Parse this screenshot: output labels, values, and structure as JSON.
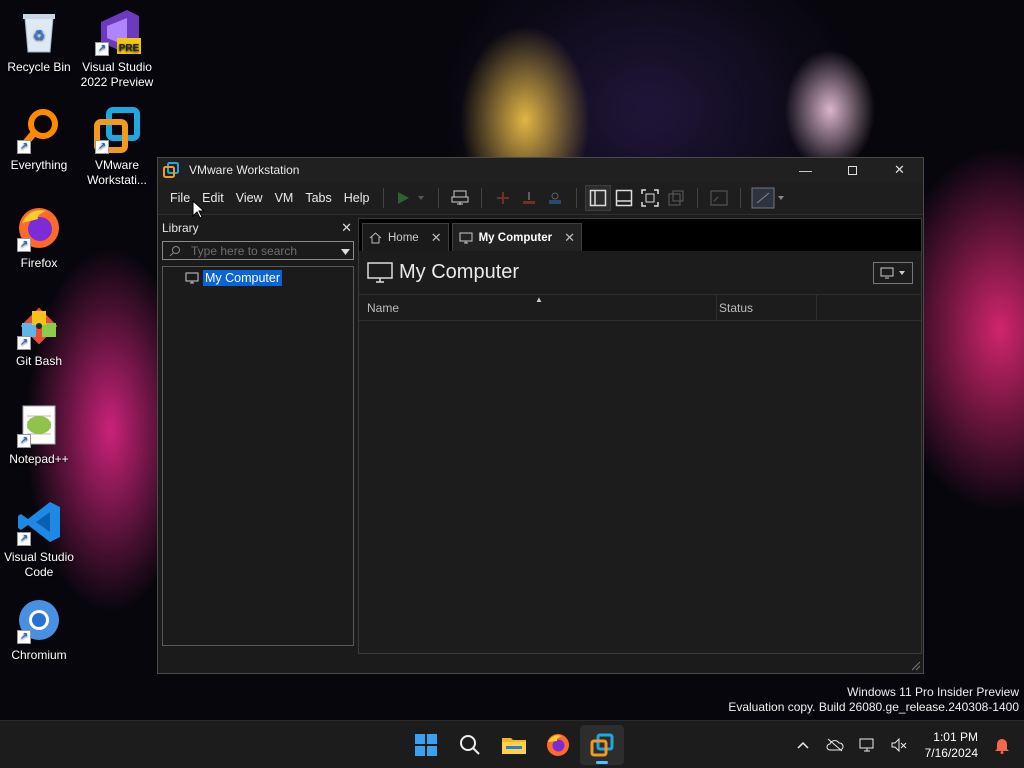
{
  "desktop": {
    "icons": [
      {
        "label": "Recycle Bin"
      },
      {
        "label": "Visual Studio 2022 Preview",
        "badge": "PRE"
      },
      {
        "label": "Everything"
      },
      {
        "label": "VMware Workstati..."
      },
      {
        "label": "Firefox"
      },
      {
        "label": "Git Bash"
      },
      {
        "label": "Notepad++"
      },
      {
        "label": "Visual Studio Code"
      },
      {
        "label": "Chromium"
      }
    ]
  },
  "window": {
    "title": "VMware Workstation",
    "menu": [
      "File",
      "Edit",
      "View",
      "VM",
      "Tabs",
      "Help"
    ]
  },
  "library": {
    "title": "Library",
    "search_placeholder": "Type here to search",
    "tree": [
      {
        "label": "My Computer",
        "selected": true
      }
    ]
  },
  "tabs": [
    {
      "label": "Home",
      "active": false
    },
    {
      "label": "My Computer",
      "active": true
    }
  ],
  "page": {
    "title": "My Computer",
    "columns": [
      "Name",
      "Status"
    ]
  },
  "watermark": {
    "line1": "Windows 11 Pro Insider Preview",
    "line2": "Evaluation copy. Build 26080.ge_release.240308-1400"
  },
  "taskbar": {
    "time": "1:01 PM",
    "date": "7/16/2024"
  },
  "colors": {
    "selection": "#0a64d6",
    "accent": "#4cc2ff",
    "play_green": "#4caf50"
  }
}
